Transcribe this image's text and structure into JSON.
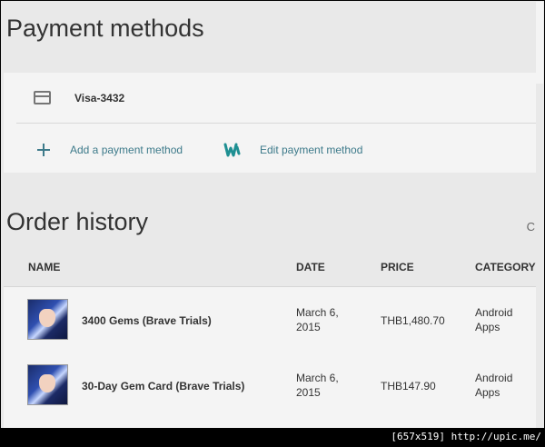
{
  "payment_methods": {
    "title": "Payment methods",
    "card_name": "Visa-3432",
    "add_label": "Add a payment method",
    "edit_label": "Edit payment method"
  },
  "order_history": {
    "title": "Order history",
    "truncated_char": "C",
    "columns": [
      "NAME",
      "DATE",
      "PRICE",
      "CATEGORY"
    ],
    "rows": [
      {
        "name": "3400 Gems (Brave Trials)",
        "date": "March 6, 2015",
        "price": "THB1,480.70",
        "category": "Android Apps"
      },
      {
        "name": "30-Day Gem Card (Brave Trials)",
        "date": "March 6, 2015",
        "price": "THB147.90",
        "category": "Android Apps"
      }
    ]
  },
  "watermark": "[657x519] http://upic.me/",
  "colors": {
    "accent": "#3d7a8a",
    "wallet": "#1e8f92"
  },
  "icons": {
    "card": "credit-card-icon",
    "add": "plus-icon",
    "edit": "wallet-icon",
    "thumb": "game-thumbnail"
  }
}
